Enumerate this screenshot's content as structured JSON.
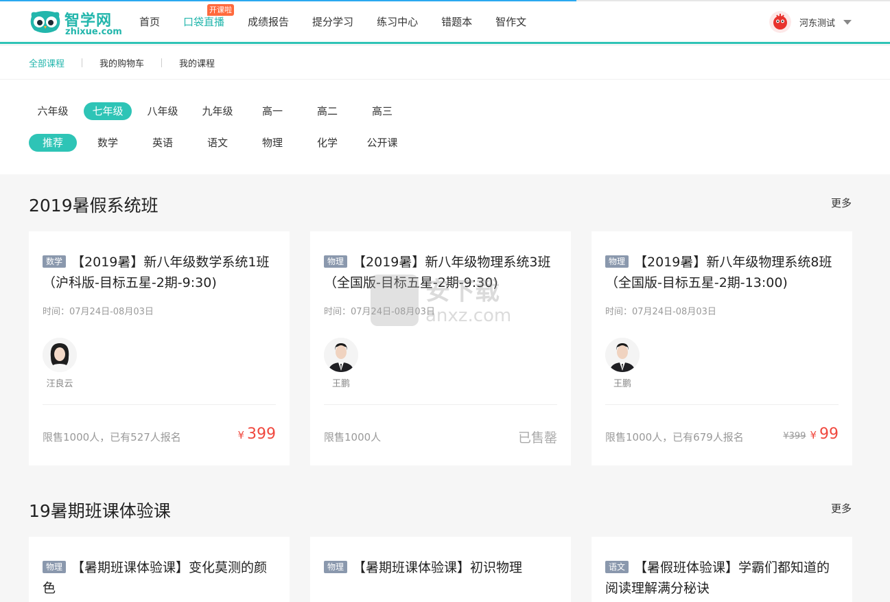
{
  "brand": {
    "name_cn": "智学网",
    "name_en": "zhixue.com",
    "accent": "#2ec4b6",
    "price_color": "#f0483e"
  },
  "nav": {
    "items": [
      {
        "label": "首页"
      },
      {
        "label": "口袋直播",
        "badge": "开课啦"
      },
      {
        "label": "成绩报告"
      },
      {
        "label": "提分学习"
      },
      {
        "label": "练习中心"
      },
      {
        "label": "错题本"
      },
      {
        "label": "智作文"
      }
    ],
    "active": "口袋直播"
  },
  "user": {
    "name": "河东测试",
    "avatar_icon": "user-avatar-icon"
  },
  "subnav": {
    "items": [
      "全部课程",
      "我的购物车",
      "我的课程"
    ],
    "active": "全部课程"
  },
  "grades": {
    "items": [
      "六年级",
      "七年级",
      "八年级",
      "九年级",
      "高一",
      "高二",
      "高三"
    ],
    "active": "七年级"
  },
  "subjects": {
    "items": [
      "推荐",
      "数学",
      "英语",
      "语文",
      "物理",
      "化学",
      "公开课"
    ],
    "active": "推荐"
  },
  "sections": [
    {
      "title": "2019暑假系统班",
      "more": "更多",
      "cards": [
        {
          "tag": "数学",
          "title": "【2019暑】新八年级数学系统1班（沪科版-目标五星-2期-9:30)",
          "time": "时间：07月24日-08月03日",
          "teacher": "汪良云",
          "limit": "限售1000人，已有527人报名",
          "currency": "¥",
          "price": "399",
          "orig_price": "",
          "soldout": ""
        },
        {
          "tag": "物理",
          "title": "【2019暑】新八年级物理系统3班（全国版-目标五星-2期-9:30)",
          "time": "时间：07月24日-08月03日",
          "teacher": "王鹏",
          "limit": "限售1000人",
          "currency": "",
          "price": "",
          "orig_price": "",
          "soldout": "已售罄"
        },
        {
          "tag": "物理",
          "title": "【2019暑】新八年级物理系统8班（全国版-目标五星-2期-13:00)",
          "time": "时间：07月24日-08月03日",
          "teacher": "王鹏",
          "limit": "限售1000人，已有679人报名",
          "currency": "¥",
          "price": "99",
          "orig_price": "¥399",
          "soldout": ""
        }
      ]
    },
    {
      "title": "19暑期班课体验课",
      "more": "更多",
      "cards": [
        {
          "tag": "物理",
          "title": "【暑期班课体验课】变化莫测的颜色"
        },
        {
          "tag": "物理",
          "title": "【暑期班课体验课】初识物理"
        },
        {
          "tag": "语文",
          "title": "【暑假班体验课】学霸们都知道的阅读理解满分秘诀"
        }
      ]
    }
  ],
  "watermark": {
    "text": "安下载",
    "sub": "anxz.com"
  }
}
